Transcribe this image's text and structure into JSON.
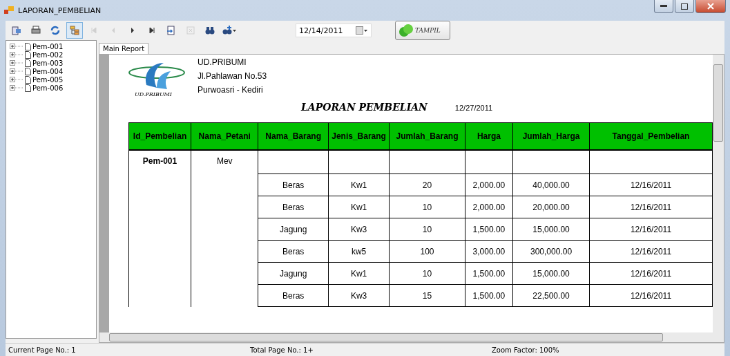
{
  "window": {
    "title": "LAPORAN_PEMBELIAN"
  },
  "toolbar": {
    "buttons": [
      {
        "kind": "export",
        "disabled": false,
        "selected": false
      },
      {
        "kind": "print",
        "disabled": false,
        "selected": false
      },
      {
        "kind": "refresh",
        "disabled": false,
        "selected": false
      },
      {
        "kind": "tree",
        "disabled": false,
        "selected": true
      },
      {
        "kind": "first",
        "disabled": true,
        "selected": false
      },
      {
        "kind": "prev",
        "disabled": true,
        "selected": false
      },
      {
        "kind": "next",
        "disabled": false,
        "selected": false
      },
      {
        "kind": "last",
        "disabled": false,
        "selected": false
      },
      {
        "kind": "goto",
        "disabled": false,
        "selected": false
      },
      {
        "kind": "stop",
        "disabled": true,
        "selected": false
      },
      {
        "kind": "find",
        "disabled": false,
        "selected": false
      },
      {
        "kind": "zoom",
        "disabled": false,
        "selected": false
      }
    ],
    "date": "12/14/2011",
    "show_button": "TAMPIL"
  },
  "tree": {
    "items": [
      {
        "label": "Pem-001"
      },
      {
        "label": "Pem-002"
      },
      {
        "label": "Pem-003"
      },
      {
        "label": "Pem-004"
      },
      {
        "label": "Pem-005"
      },
      {
        "label": "Pem-006"
      }
    ]
  },
  "tabs": [
    {
      "label": "Main Report",
      "selected": true
    }
  ],
  "report": {
    "logo_text": "UD.PRIBUMI",
    "company": [
      "UD.PRIBUMI",
      "Jl.Pahlawan No.53",
      "Purwoasri - Kediri"
    ],
    "title": "LAPORAN PEMBELIAN",
    "print_date": "12/27/2011",
    "columns": [
      "Id_Pembelian",
      "Nama_Petani",
      "Nama_Barang",
      "Jenis_Barang",
      "Jumlah_Barang",
      "Harga",
      "Jumlah_Harga",
      "Tanggal_Pembelian"
    ],
    "rows": [
      [
        "Pem-001",
        "Mev",
        "",
        "",
        "",
        "",
        "",
        ""
      ],
      [
        "",
        "",
        "Beras",
        "Kw1",
        "20",
        "2,000.00",
        "40,000.00",
        "12/16/2011"
      ],
      [
        "",
        "",
        "Beras",
        "Kw1",
        "10",
        "2,000.00",
        "20,000.00",
        "12/16/2011"
      ],
      [
        "",
        "",
        "Jagung",
        "Kw3",
        "10",
        "1,500.00",
        "15,000.00",
        "12/16/2011"
      ],
      [
        "",
        "",
        "Beras",
        "kw5",
        "100",
        "3,000.00",
        "300,000.00",
        "12/16/2011"
      ],
      [
        "",
        "",
        "Jagung",
        "Kw1",
        "10",
        "1,500.00",
        "15,000.00",
        "12/16/2011"
      ],
      [
        "",
        "",
        "Beras",
        "Kw3",
        "15",
        "1,500.00",
        "22,500.00",
        "12/16/2011"
      ]
    ]
  },
  "status_bar": [
    "Current Page No.: 1",
    "Total Page No.: 1+",
    "Zoom Factor: 100%"
  ]
}
